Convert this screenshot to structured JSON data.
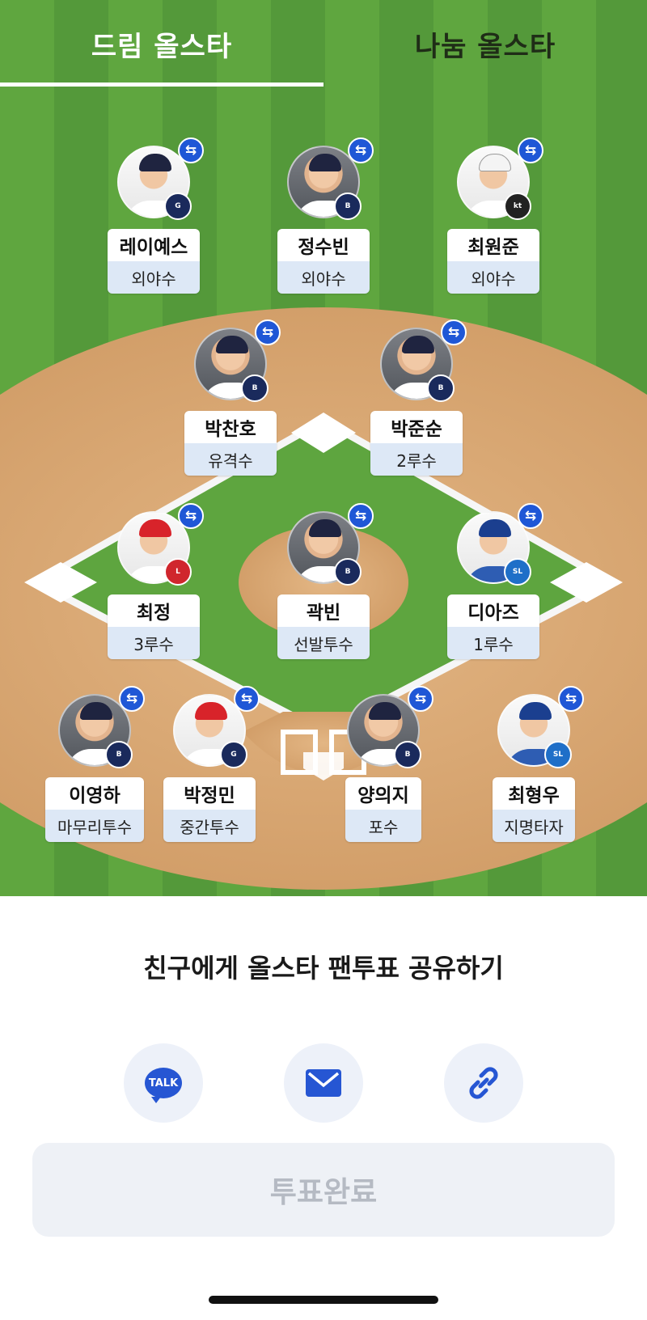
{
  "tabs": {
    "active": "드림 올스타",
    "inactive": "나눔 올스타"
  },
  "swap_symbol": "⇆",
  "players": [
    {
      "name": "레이예스",
      "position": "외야수",
      "team_logo": "Giants"
    },
    {
      "name": "정수빈",
      "position": "외야수",
      "team_logo": "Bears"
    },
    {
      "name": "최원준",
      "position": "외야수",
      "team_logo": "KT"
    },
    {
      "name": "박찬호",
      "position": "유격수",
      "team_logo": "Bears"
    },
    {
      "name": "박준순",
      "position": "2루수",
      "team_logo": "Bears"
    },
    {
      "name": "최정",
      "position": "3루수",
      "team_logo": "Landers"
    },
    {
      "name": "곽빈",
      "position": "선발투수",
      "team_logo": "Bears"
    },
    {
      "name": "디아즈",
      "position": "1루수",
      "team_logo": "Lions"
    },
    {
      "name": "이영하",
      "position": "마무리투수",
      "team_logo": "Bears"
    },
    {
      "name": "박정민",
      "position": "중간투수",
      "team_logo": "Giants"
    },
    {
      "name": "양의지",
      "position": "포수",
      "team_logo": "Bears"
    },
    {
      "name": "최형우",
      "position": "지명타자",
      "team_logo": "Lions"
    }
  ],
  "share": {
    "title": "친구에게 올스타 팬투표 공유하기",
    "kakao_label": "TALK"
  },
  "vote_button": "투표완료",
  "colors": {
    "accent": "#1f57d6",
    "field_green": "#5fa63f",
    "dirt": "#d9a873"
  },
  "icons": [
    "swap-icon",
    "kakaotalk-icon",
    "mail-icon",
    "link-icon"
  ]
}
